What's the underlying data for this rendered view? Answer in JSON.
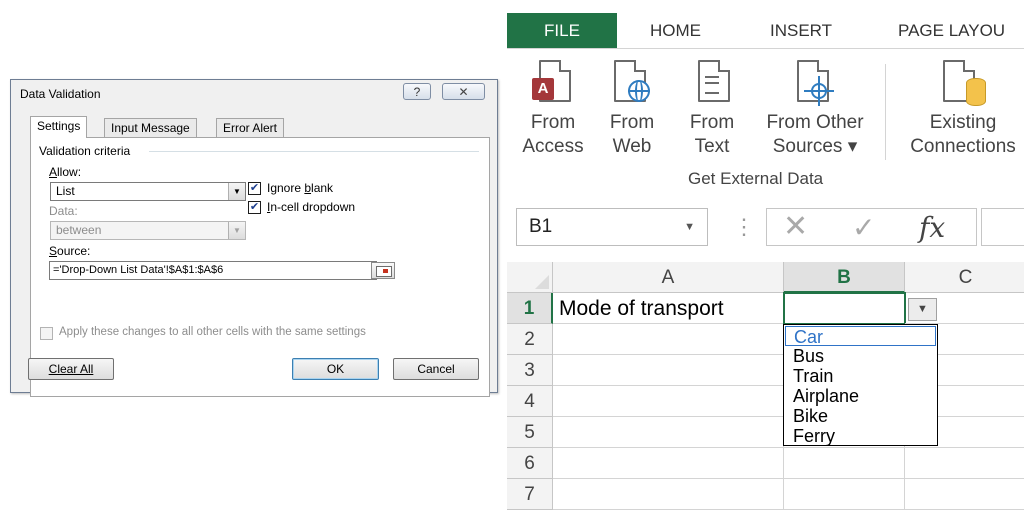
{
  "dialog": {
    "title": "Data Validation",
    "help_label": "?",
    "close_label": "✕",
    "tabs": [
      {
        "label": "Settings"
      },
      {
        "label": "Input Message"
      },
      {
        "label": "Error Alert"
      }
    ],
    "validation_criteria_label": "Validation criteria",
    "allow_label": "Allow:",
    "allow_value": "List",
    "data_label": "Data:",
    "data_value": "between",
    "ignore_blank_label": "Ignore blank",
    "ignore_blank_checked": true,
    "in_cell_dropdown_label": "In-cell dropdown",
    "in_cell_dropdown_checked": true,
    "source_label": "Source:",
    "source_value": "='Drop-Down List Data'!$A$1:$A$6",
    "apply_all_label": "Apply these changes to all other cells with the same settings",
    "apply_all_checked": false,
    "buttons": {
      "clear_all": "Clear All",
      "ok": "OK",
      "cancel": "Cancel"
    }
  },
  "excel": {
    "ribbon_tabs": [
      {
        "label": "FILE"
      },
      {
        "label": "HOME"
      },
      {
        "label": "INSERT"
      },
      {
        "label": "PAGE LAYOU"
      }
    ],
    "ribbon_buttons": [
      {
        "line1": "From",
        "line2": "Access",
        "icon": "access-icon"
      },
      {
        "line1": "From",
        "line2": "Web",
        "icon": "web-icon"
      },
      {
        "line1": "From",
        "line2": "Text",
        "icon": "text-file-icon"
      },
      {
        "line1": "From Other",
        "line2": "Sources ▾",
        "icon": "other-sources-icon"
      },
      {
        "line1": "Existing",
        "line2": "Connections",
        "icon": "connections-icon"
      }
    ],
    "ribbon_group_label": "Get External Data",
    "name_box": "B1",
    "formula_icons": {
      "cancel": "✕",
      "enter": "✓",
      "function": "fx",
      "dots": "⋮"
    },
    "columns": [
      "A",
      "B",
      "C"
    ],
    "rows": [
      "1",
      "2",
      "3",
      "4",
      "5",
      "6",
      "7"
    ],
    "cells": {
      "A1": "Mode of transport"
    },
    "dropdown_options": [
      "Car",
      "Bus",
      "Train",
      "Airplane",
      "Bike",
      "Ferry"
    ],
    "highlighted_option": "Car",
    "accent_color": "#217346"
  }
}
